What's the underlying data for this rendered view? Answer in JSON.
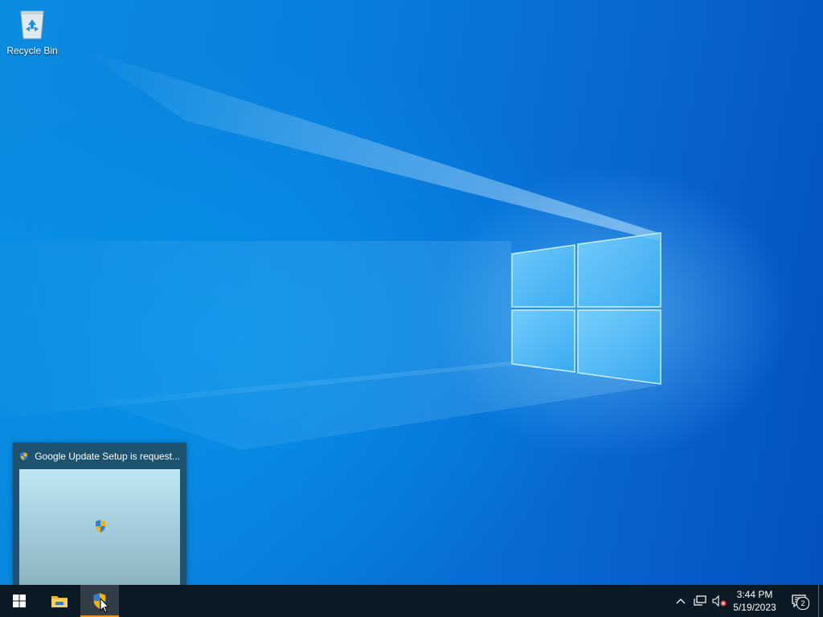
{
  "desktop": {
    "icons": [
      {
        "label": "Recycle Bin",
        "icon": "recycle-bin-icon"
      }
    ]
  },
  "preview": {
    "title": "Google Update Setup is request...",
    "icon": "uac-shield-icon"
  },
  "taskbar": {
    "start_icon": "windows-start-icon",
    "pinned": [
      {
        "name": "file-explorer",
        "icon": "folder-icon",
        "active": false
      },
      {
        "name": "google-update-setup",
        "icon": "uac-shield-icon",
        "active": true
      }
    ],
    "tray": {
      "chevron_icon": "chevron-up-icon",
      "network_icon": "network-icon",
      "volume_icon": "volume-muted-icon",
      "time": "3:44 PM",
      "date": "5/19/2023",
      "notification_icon": "action-center-icon",
      "notification_count": "2"
    }
  },
  "colors": {
    "wallpaper": "#0a7fde",
    "taskbar": "#0b1a24",
    "active_underline": "#e8912a"
  }
}
